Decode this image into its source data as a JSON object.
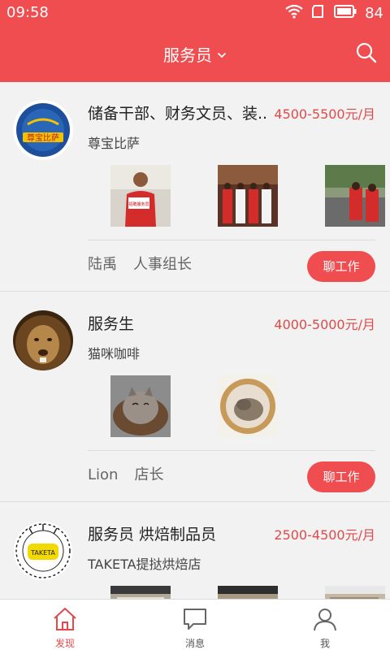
{
  "status": {
    "time": "09:58",
    "battery": "84"
  },
  "header": {
    "title": "服务员"
  },
  "jobs": [
    {
      "title": "储备干部、财务文员、装..",
      "salary": "4500-5500元/月",
      "company": "尊宝比萨",
      "logo_text": "尊宝比萨",
      "photo_caption": "招聘服务员",
      "contact_name": "陆禹",
      "contact_role": "人事组长",
      "action_label": "聊工作"
    },
    {
      "title": "服务生",
      "salary": "4000-5000元/月",
      "company": "猫咪咖啡",
      "contact_name": "Lion",
      "contact_role": "店长",
      "action_label": "聊工作"
    },
    {
      "title": "服务员 烘焙制品员",
      "salary": "2500-4500元/月",
      "company": "TAKETA提挞烘焙店",
      "logo_text": "TAKETA",
      "contact_name": "",
      "contact_role": "",
      "action_label": ""
    }
  ],
  "tabs": [
    {
      "label": "发现",
      "icon": "home-icon",
      "active": true
    },
    {
      "label": "消息",
      "icon": "message-icon",
      "active": false
    },
    {
      "label": "我",
      "icon": "profile-icon",
      "active": false
    }
  ],
  "colors": {
    "brand": "#ef4d4f",
    "salary": "#e04a4a",
    "background": "#f2f2f2"
  }
}
